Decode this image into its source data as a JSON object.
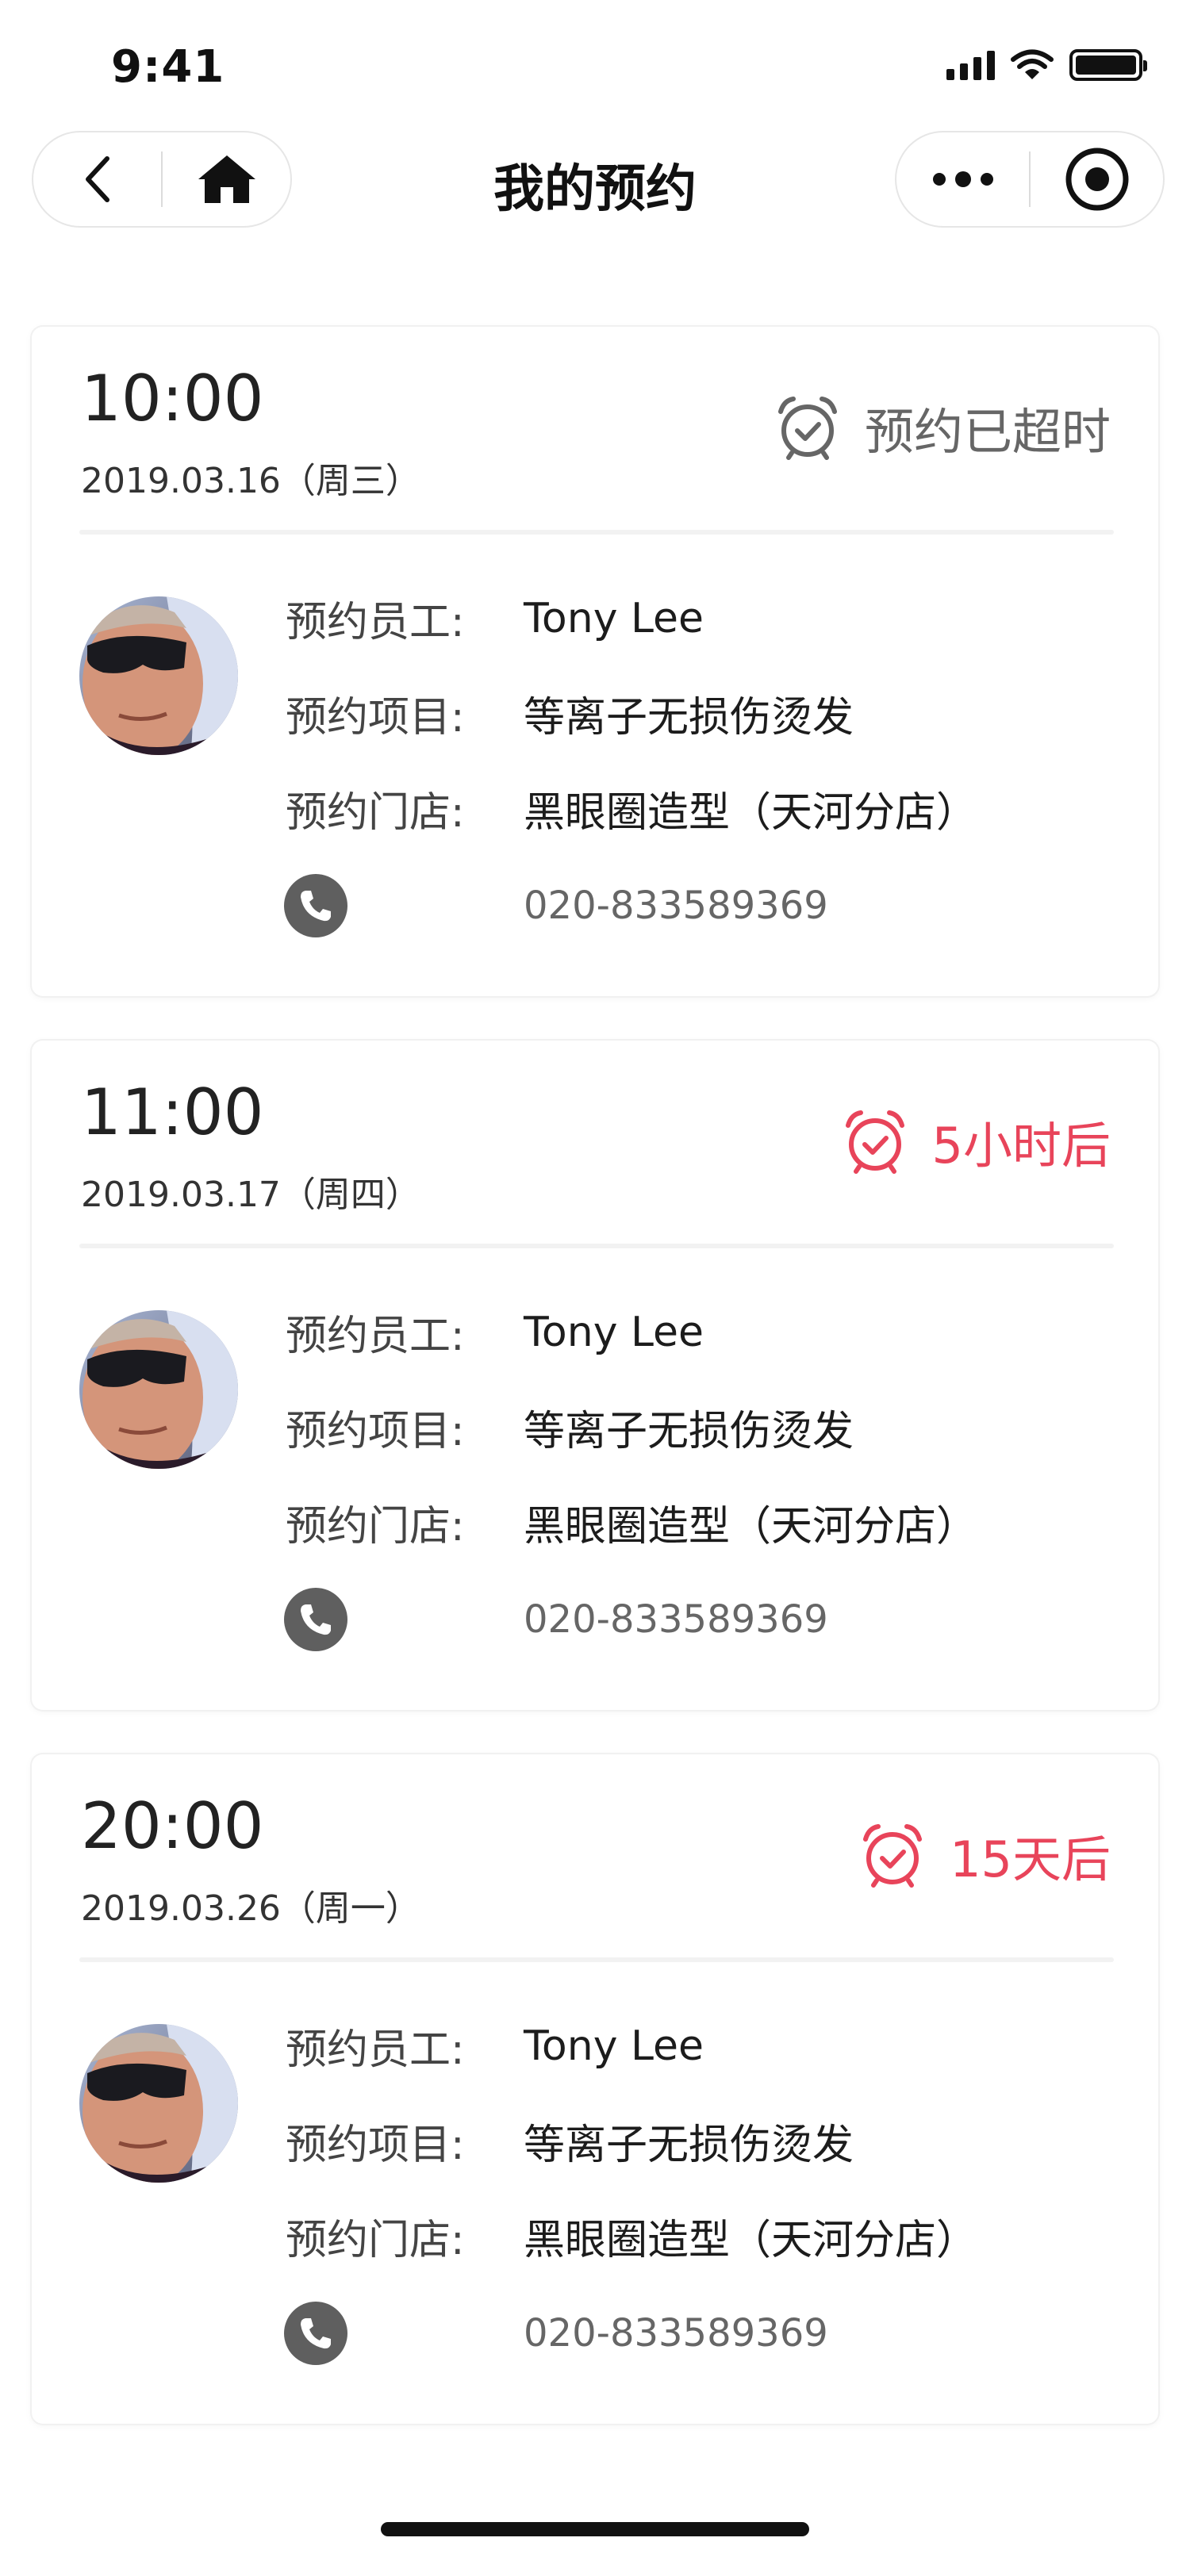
{
  "status_bar": {
    "time": "9:41"
  },
  "nav": {
    "title": "我的预约"
  },
  "colors": {
    "accent": "#e8445a",
    "overdue": "#666666",
    "phone_icon_bg": "#5f5f5f"
  },
  "labels": {
    "staff": "预约员工:",
    "service": "预约项目:",
    "store": "预约门店:"
  },
  "appointments": [
    {
      "time": "10:00",
      "date": "2019.03.16（周三）",
      "status": "预约已超时",
      "status_type": "overdue",
      "staff": "Tony Lee",
      "service": "等离子无损伤烫发",
      "store": "黑眼圈造型（天河分店）",
      "phone": "020-833589369"
    },
    {
      "time": "11:00",
      "date": "2019.03.17（周四）",
      "status": "5小时后",
      "status_type": "upcoming",
      "staff": "Tony Lee",
      "service": "等离子无损伤烫发",
      "store": "黑眼圈造型（天河分店）",
      "phone": "020-833589369"
    },
    {
      "time": "20:00",
      "date": "2019.03.26（周一）",
      "status": "15天后",
      "status_type": "upcoming",
      "staff": "Tony Lee",
      "service": "等离子无损伤烫发",
      "store": "黑眼圈造型（天河分店）",
      "phone": "020-833589369"
    }
  ]
}
